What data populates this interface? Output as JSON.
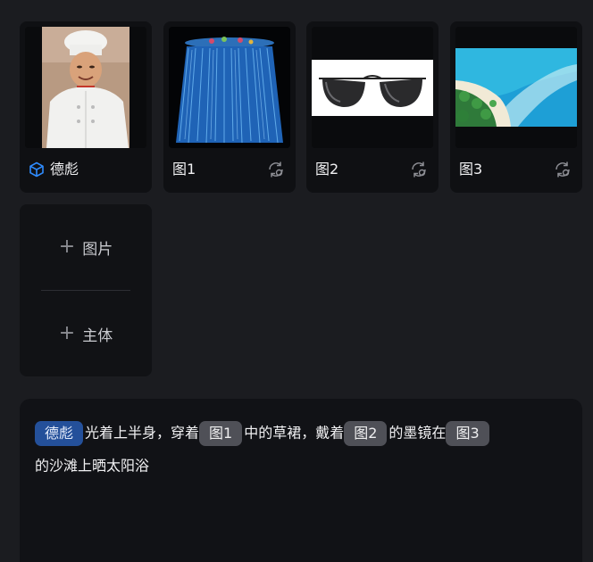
{
  "cards": [
    {
      "label": "德彪",
      "kind": "subject",
      "image": "chef-portrait",
      "icon": "cube-icon"
    },
    {
      "label": "图1",
      "kind": "image",
      "image": "blue-grass-skirt",
      "icon": "swap-icon"
    },
    {
      "label": "图2",
      "kind": "image",
      "image": "aviator-sunglasses",
      "icon": "swap-icon"
    },
    {
      "label": "图3",
      "kind": "image",
      "image": "tropical-beach",
      "icon": "swap-icon"
    }
  ],
  "add_panel": {
    "image_label": "图片",
    "subject_label": "主体"
  },
  "prompt": {
    "tag_subject": "德彪",
    "seg1": "光着上半身，穿着",
    "tag_img1": "图1",
    "seg2": "中的草裙，戴着",
    "tag_img2": "图2",
    "seg3": "的墨镜在",
    "tag_img3": "图3",
    "seg4": "的沙滩上晒太阳浴"
  },
  "colors": {
    "background": "#1b1c20",
    "card": "#0f1013",
    "subject_tag": "#24509a",
    "image_tag": "#4f5057",
    "accent_icon": "#2f8cff"
  }
}
